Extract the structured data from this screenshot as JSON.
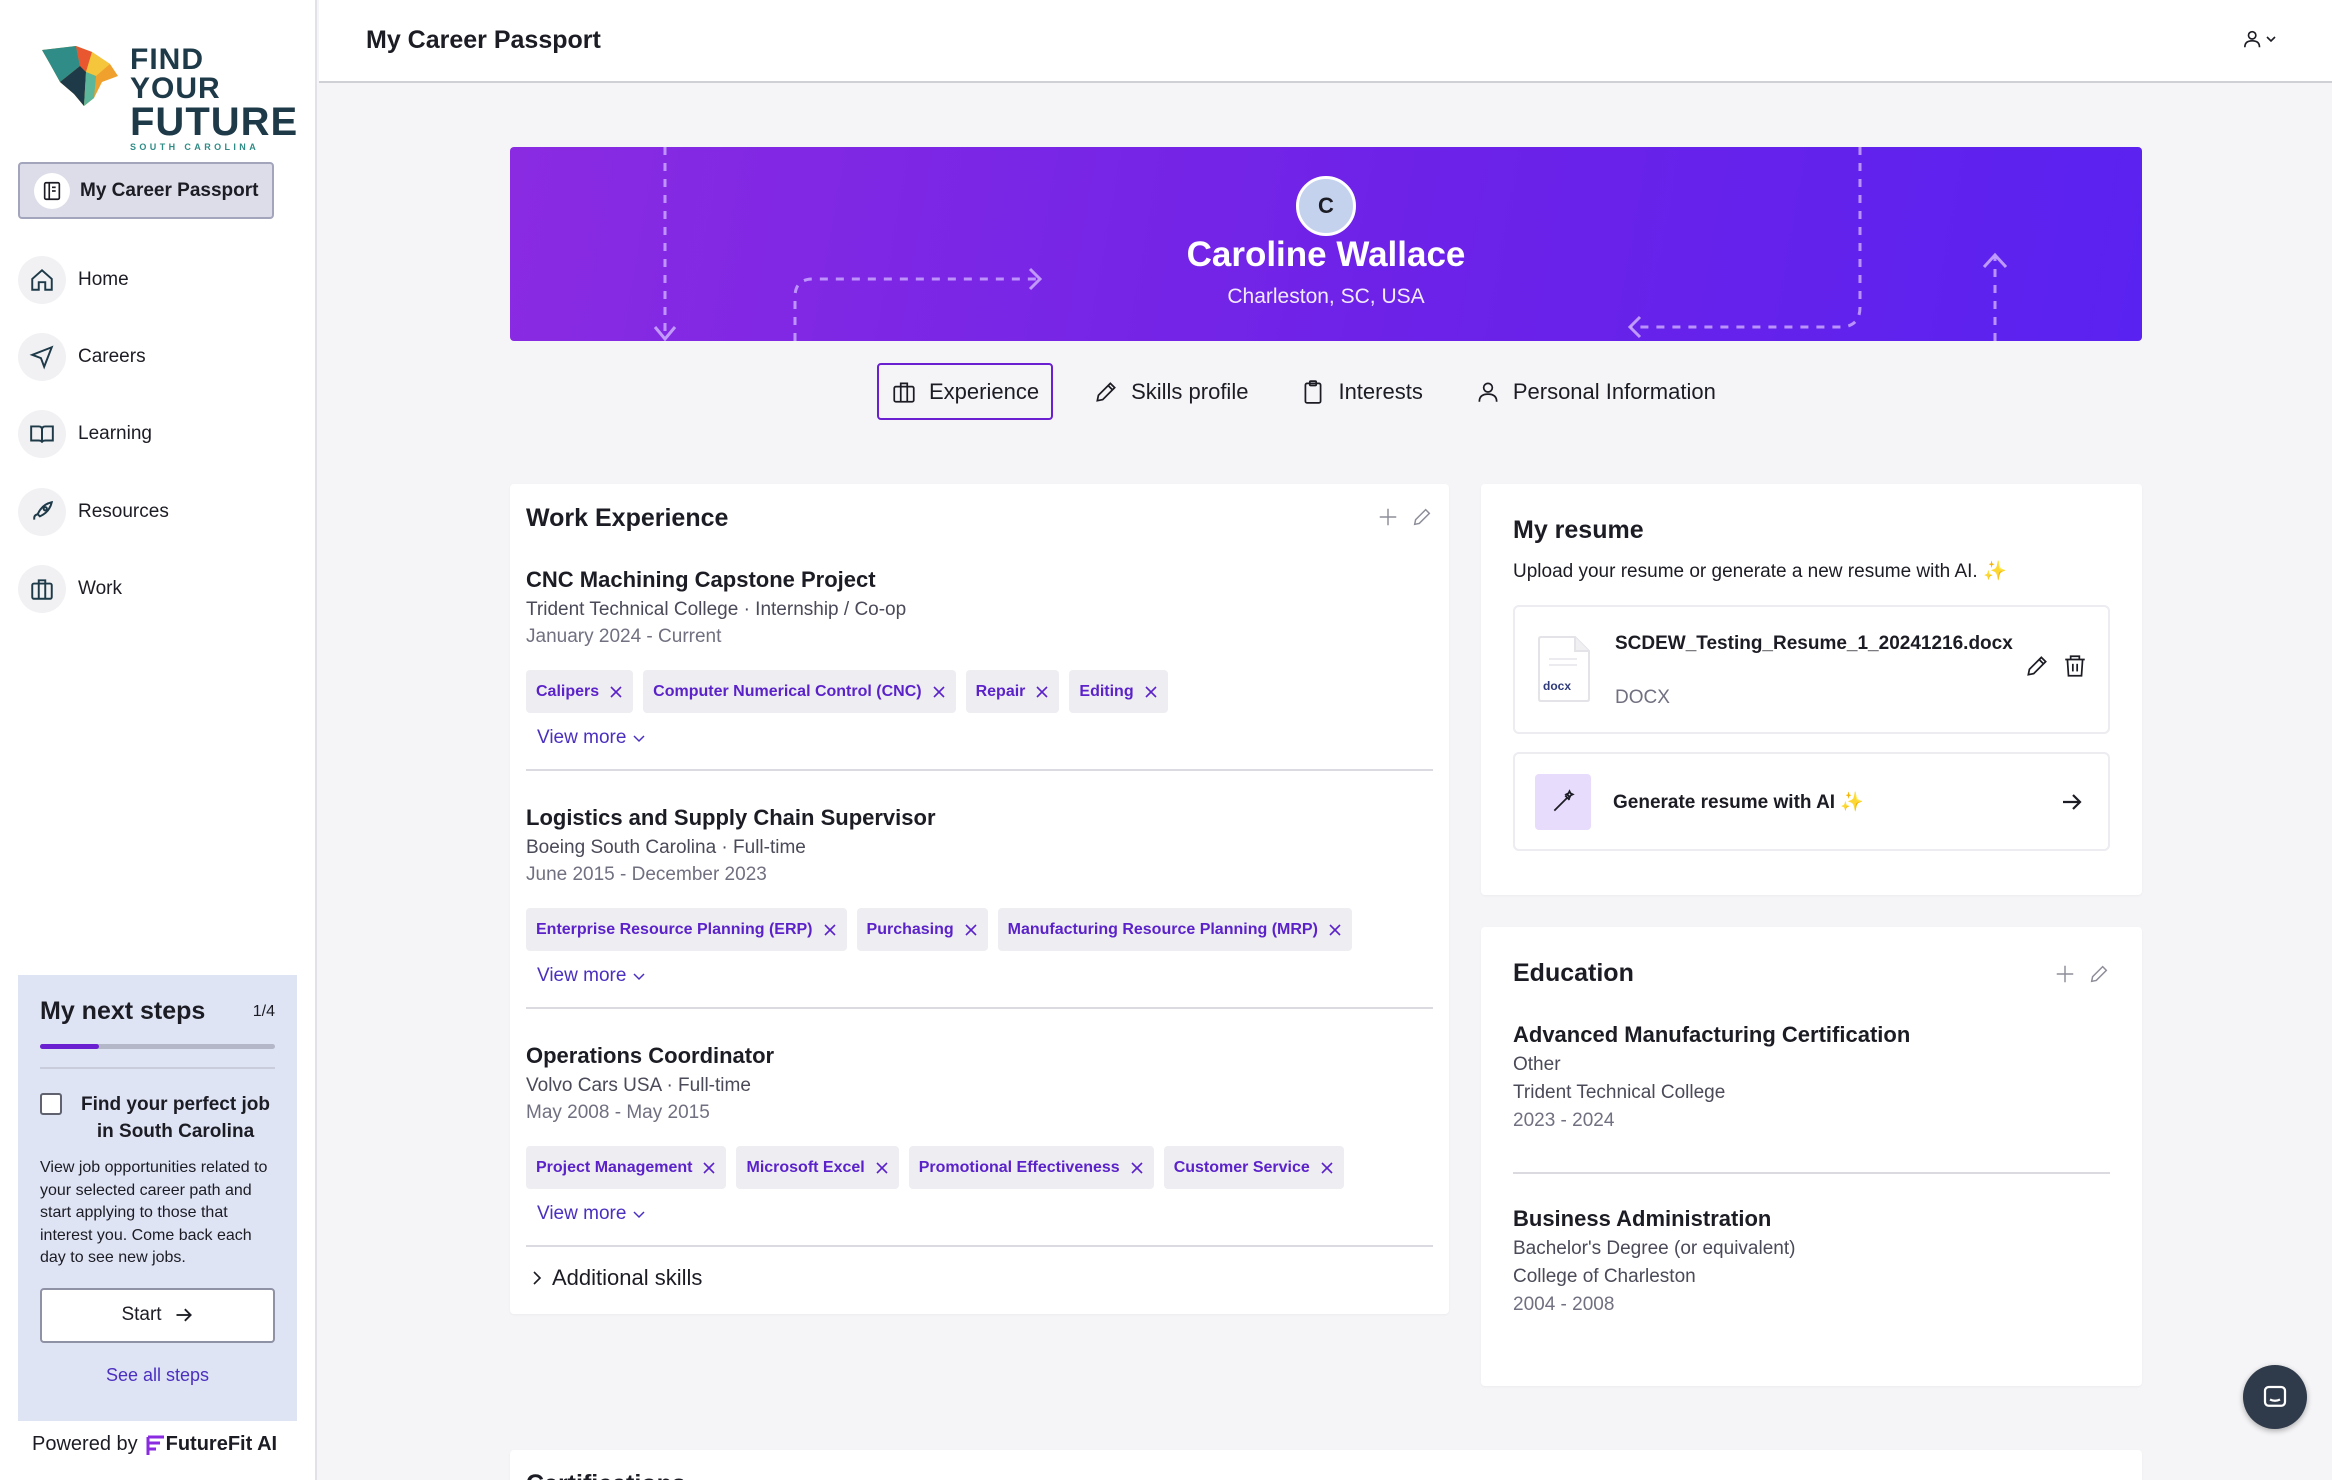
{
  "app": {
    "page_title": "My Career Passport",
    "logo": {
      "line1": "FIND YOUR",
      "line2": "FUTURE",
      "line3": "SOUTH CAROLINA"
    }
  },
  "sidebar": {
    "active": {
      "label": "My Career Passport",
      "icon": "passport-icon"
    },
    "items": [
      {
        "label": "Home",
        "icon": "home-icon"
      },
      {
        "label": "Careers",
        "icon": "navigation-icon"
      },
      {
        "label": "Learning",
        "icon": "book-icon"
      },
      {
        "label": "Resources",
        "icon": "rocket-icon"
      },
      {
        "label": "Work",
        "icon": "briefcase-icon"
      }
    ],
    "next_steps": {
      "title": "My next steps",
      "count": "1/4",
      "progress": 0.25,
      "task_title": "Find your perfect job in South Carolina",
      "task_desc": "View job opportunities related to your selected career path and start applying to those that interest you. Come back each day to see new jobs.",
      "start_label": "Start",
      "see_all": "See all steps"
    },
    "powered_by": "Powered by",
    "powered_brand": "FutureFit AI"
  },
  "profile": {
    "initial": "C",
    "name": "Caroline Wallace",
    "location": "Charleston, SC, USA"
  },
  "tabs": [
    {
      "label": "Experience",
      "icon": "briefcase-icon",
      "active": true
    },
    {
      "label": "Skills profile",
      "icon": "pencil-icon",
      "active": false
    },
    {
      "label": "Interests",
      "icon": "clipboard-icon",
      "active": false
    },
    {
      "label": "Personal Information",
      "icon": "user-icon",
      "active": false
    }
  ],
  "work": {
    "title": "Work Experience",
    "jobs": [
      {
        "title": "CNC Machining Capstone Project",
        "sub": "Trident Technical College · Internship / Co-op",
        "date": "January 2024 - Current",
        "skills": [
          "Calipers",
          "Computer Numerical Control (CNC)",
          "Repair",
          "Editing"
        ],
        "view_more": "View more"
      },
      {
        "title": "Logistics and Supply Chain Supervisor",
        "sub": "Boeing South Carolina · Full-time",
        "date": "June 2015 - December 2023",
        "skills": [
          "Enterprise Resource Planning (ERP)",
          "Purchasing",
          "Manufacturing Resource Planning (MRP)"
        ],
        "view_more": "View more"
      },
      {
        "title": "Operations Coordinator",
        "sub": "Volvo Cars USA · Full-time",
        "date": "May 2008 - May 2015",
        "skills": [
          "Project Management",
          "Microsoft Excel",
          "Promotional Effectiveness",
          "Customer Service"
        ],
        "view_more": "View more"
      }
    ],
    "additional_skills": "Additional skills"
  },
  "resume": {
    "title": "My resume",
    "subtitle": "Upload your resume or generate a new resume with AI. ✨",
    "file_name": "SCDEW_Testing_Resume_1_20241216.docx",
    "file_type": "DOCX",
    "doc_badge": "docx",
    "generate_label": "Generate resume with AI ✨"
  },
  "education": {
    "title": "Education",
    "items": [
      {
        "title": "Advanced Manufacturing Certification",
        "type": "Other",
        "school": "Trident Technical College",
        "date": "2023 - 2024"
      },
      {
        "title": "Business Administration",
        "type": "Bachelor's Degree (or equivalent)",
        "school": "College of Charleston",
        "date": "2004 - 2008"
      }
    ]
  },
  "certifications": {
    "title": "Certifications"
  },
  "colors": {
    "accent": "#6a1fd1",
    "banner_start": "#8a2be2",
    "banner_end": "#5a22f0",
    "chip_text": "#5b22c9"
  }
}
